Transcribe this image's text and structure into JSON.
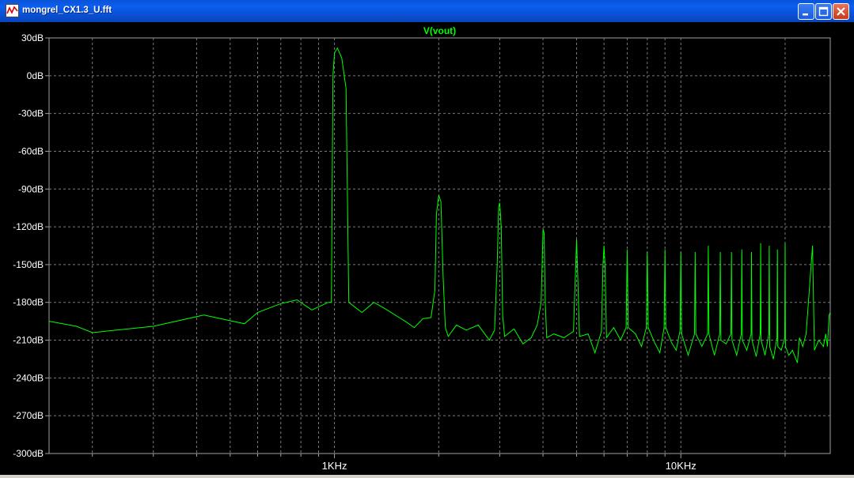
{
  "window": {
    "title": "mongrel_CX1.3_U.fft",
    "colors": {
      "titlebar": "#0b5ef0",
      "plot_bg": "#000000",
      "trace": "#00ff00",
      "grid": "#7f7f7f"
    }
  },
  "chart_data": {
    "type": "line",
    "title": "V(vout)",
    "xlabel": "",
    "ylabel": "",
    "xscale": "log",
    "xlim": [
      150,
      27000
    ],
    "ylim": [
      -300,
      30
    ],
    "y_ticks": [
      30,
      0,
      -30,
      -60,
      -90,
      -120,
      -150,
      -180,
      -210,
      -240,
      -270,
      -300
    ],
    "y_tick_labels": [
      "30dB",
      "0dB",
      "-30dB",
      "-60dB",
      "-90dB",
      "-120dB",
      "-150dB",
      "-180dB",
      "-210dB",
      "-240dB",
      "-270dB",
      "-300dB"
    ],
    "x_tick_labels": [
      {
        "value": 1000,
        "label": "1KHz"
      },
      {
        "value": 10000,
        "label": "10KHz"
      }
    ],
    "x_minor_ticks": [
      200,
      300,
      400,
      500,
      600,
      700,
      800,
      900,
      2000,
      3000,
      4000,
      5000,
      6000,
      7000,
      8000,
      9000,
      20000
    ],
    "grid": true,
    "series": [
      {
        "color": "#00ff00",
        "points": [
          [
            150,
            -195
          ],
          [
            180,
            -199
          ],
          [
            200,
            -204
          ],
          [
            300,
            -199
          ],
          [
            420,
            -190
          ],
          [
            550,
            -197
          ],
          [
            600,
            -188
          ],
          [
            700,
            -181
          ],
          [
            780,
            -178
          ],
          [
            860,
            -186
          ],
          [
            960,
            -180
          ],
          [
            980,
            -180
          ],
          [
            990,
            0
          ],
          [
            1000,
            18
          ],
          [
            1020,
            22
          ],
          [
            1050,
            14
          ],
          [
            1080,
            -10
          ],
          [
            1100,
            -180
          ],
          [
            1200,
            -188
          ],
          [
            1300,
            -180
          ],
          [
            1400,
            -185
          ],
          [
            1600,
            -195
          ],
          [
            1700,
            -200
          ],
          [
            1800,
            -193
          ],
          [
            1900,
            -192
          ],
          [
            1950,
            -170
          ],
          [
            1970,
            -110
          ],
          [
            2000,
            -95
          ],
          [
            2030,
            -100
          ],
          [
            2060,
            -160
          ],
          [
            2090,
            -200
          ],
          [
            2130,
            -207
          ],
          [
            2250,
            -198
          ],
          [
            2400,
            -202
          ],
          [
            2600,
            -198
          ],
          [
            2800,
            -210
          ],
          [
            2900,
            -202
          ],
          [
            2950,
            -150
          ],
          [
            2980,
            -104
          ],
          [
            3000,
            -101
          ],
          [
            3030,
            -120
          ],
          [
            3060,
            -190
          ],
          [
            3100,
            -207
          ],
          [
            3300,
            -201
          ],
          [
            3500,
            -213
          ],
          [
            3700,
            -208
          ],
          [
            3850,
            -198
          ],
          [
            3950,
            -180
          ],
          [
            4000,
            -122
          ],
          [
            4030,
            -125
          ],
          [
            4060,
            -180
          ],
          [
            4100,
            -208
          ],
          [
            4300,
            -205
          ],
          [
            4600,
            -208
          ],
          [
            4900,
            -203
          ],
          [
            4960,
            -160
          ],
          [
            5000,
            -130
          ],
          [
            5040,
            -160
          ],
          [
            5100,
            -207
          ],
          [
            5400,
            -205
          ],
          [
            5650,
            -220
          ],
          [
            5900,
            -203
          ],
          [
            5960,
            -150
          ],
          [
            6000,
            -135
          ],
          [
            6040,
            -150
          ],
          [
            6100,
            -208
          ],
          [
            6400,
            -200
          ],
          [
            6700,
            -210
          ],
          [
            6950,
            -200
          ],
          [
            7000,
            -138
          ],
          [
            7050,
            -200
          ],
          [
            7400,
            -205
          ],
          [
            7700,
            -215
          ],
          [
            7950,
            -200
          ],
          [
            8000,
            -140
          ],
          [
            8050,
            -200
          ],
          [
            8400,
            -212
          ],
          [
            8700,
            -220
          ],
          [
            8950,
            -200
          ],
          [
            9000,
            -138
          ],
          [
            9050,
            -200
          ],
          [
            9400,
            -212
          ],
          [
            9700,
            -218
          ],
          [
            9950,
            -202
          ],
          [
            10000,
            -140
          ],
          [
            10050,
            -205
          ],
          [
            10500,
            -222
          ],
          [
            10950,
            -205
          ],
          [
            11000,
            -140
          ],
          [
            11050,
            -205
          ],
          [
            11500,
            -215
          ],
          [
            11950,
            -205
          ],
          [
            12000,
            -135
          ],
          [
            12050,
            -205
          ],
          [
            12500,
            -222
          ],
          [
            12950,
            -205
          ],
          [
            13000,
            -140
          ],
          [
            13050,
            -210
          ],
          [
            13500,
            -213
          ],
          [
            13950,
            -205
          ],
          [
            14000,
            -140
          ],
          [
            14050,
            -210
          ],
          [
            14500,
            -222
          ],
          [
            14950,
            -205
          ],
          [
            15000,
            -138
          ],
          [
            15050,
            -210
          ],
          [
            15500,
            -218
          ],
          [
            15950,
            -205
          ],
          [
            16000,
            -140
          ],
          [
            16050,
            -210
          ],
          [
            16500,
            -223
          ],
          [
            16950,
            -205
          ],
          [
            17000,
            -133
          ],
          [
            17050,
            -210
          ],
          [
            17500,
            -222
          ],
          [
            17950,
            -205
          ],
          [
            18000,
            -135
          ],
          [
            18050,
            -215
          ],
          [
            18500,
            -225
          ],
          [
            18950,
            -208
          ],
          [
            19000,
            -138
          ],
          [
            19050,
            -215
          ],
          [
            19500,
            -218
          ],
          [
            19950,
            -208
          ],
          [
            20000,
            -133
          ],
          [
            20050,
            -215
          ],
          [
            20500,
            -222
          ],
          [
            21000,
            -218
          ],
          [
            21700,
            -228
          ],
          [
            22000,
            -208
          ],
          [
            22500,
            -215
          ],
          [
            23000,
            -205
          ],
          [
            24000,
            -135
          ],
          [
            24300,
            -218
          ],
          [
            25000,
            -210
          ],
          [
            25800,
            -215
          ],
          [
            26200,
            -205
          ],
          [
            26500,
            -215
          ],
          [
            26800,
            -190
          ],
          [
            27000,
            -188
          ]
        ]
      }
    ]
  }
}
